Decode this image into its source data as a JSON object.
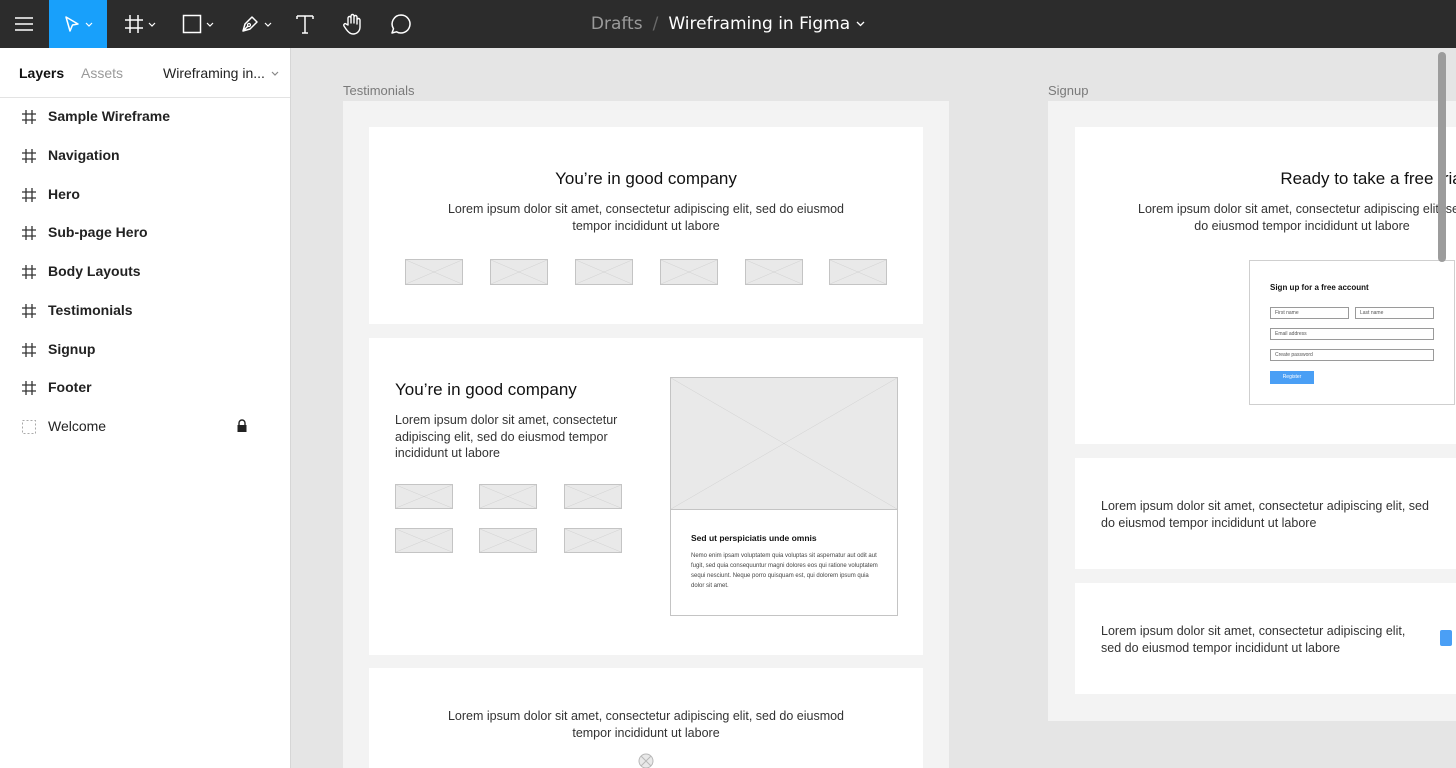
{
  "colors": {
    "toolbar": "#2c2c2c",
    "accent": "#18a0fb",
    "canvas": "#e5e5e5"
  },
  "toolbar": {
    "icons": [
      "menu-icon",
      "move-icon",
      "frame-icon",
      "rectangle-icon",
      "pen-icon",
      "text-icon",
      "hand-icon",
      "comment-icon"
    ],
    "breadcrumb_drafts": "Drafts",
    "breadcrumb_sep": "/",
    "file_name": "Wireframing in Figma"
  },
  "panel": {
    "tab_layers": "Layers",
    "tab_assets": "Assets",
    "page_name": "Wireframing in...",
    "layers": [
      {
        "name": "Sample Wireframe"
      },
      {
        "name": "Navigation"
      },
      {
        "name": "Hero"
      },
      {
        "name": "Sub-page Hero"
      },
      {
        "name": "Body Layouts"
      },
      {
        "name": "Testimonials"
      },
      {
        "name": "Signup"
      },
      {
        "name": "Footer"
      },
      {
        "name": "Welcome",
        "locked": true
      }
    ]
  },
  "canvas": {
    "testimonials": {
      "label": "Testimonials",
      "card1": {
        "heading": "You’re in good company",
        "body": "Lorem ipsum dolor sit amet, consectetur adipiscing elit, sed do eiusmod tempor incididunt ut labore"
      },
      "card2": {
        "heading": "You’re in good company",
        "body": "Lorem ipsum dolor sit amet, consectetur adipiscing elit, sed do eiusmod tempor incididunt ut labore",
        "panel_title": "Sed ut perspiciatis unde omnis",
        "panel_body": "Nemo enim ipsam voluptatem quia voluptas sit aspernatur aut odit aut fugit, sed quia consequuntur magni dolores eos qui ratione voluptatem sequi nesciunt. Neque porro quisquam est, qui dolorem ipsum quia dolor sit amet."
      },
      "card3": {
        "body": "Lorem ipsum dolor sit amet, consectetur adipiscing elit, sed do eiusmod tempor incididunt ut labore"
      }
    },
    "signup": {
      "label": "Signup",
      "card1": {
        "heading": "Ready to take a free trial?",
        "body": "Lorem ipsum dolor sit amet, consectetur adipiscing elit, sed do eiusmod tempor incididunt ut labore"
      },
      "form": {
        "title": "Sign up for a free account",
        "first_name": "First name",
        "last_name": "Last name",
        "email": "Email address",
        "password": "Create password",
        "button": "Register"
      },
      "card2": {
        "body": "Lorem ipsum dolor sit amet, consectetur adipiscing elit, sed do eiusmod tempor incididunt ut labore"
      },
      "card3": {
        "body": "Lorem ipsum dolor sit amet, consectetur adipiscing elit, sed do eiusmod tempor incididunt ut labore"
      }
    }
  }
}
